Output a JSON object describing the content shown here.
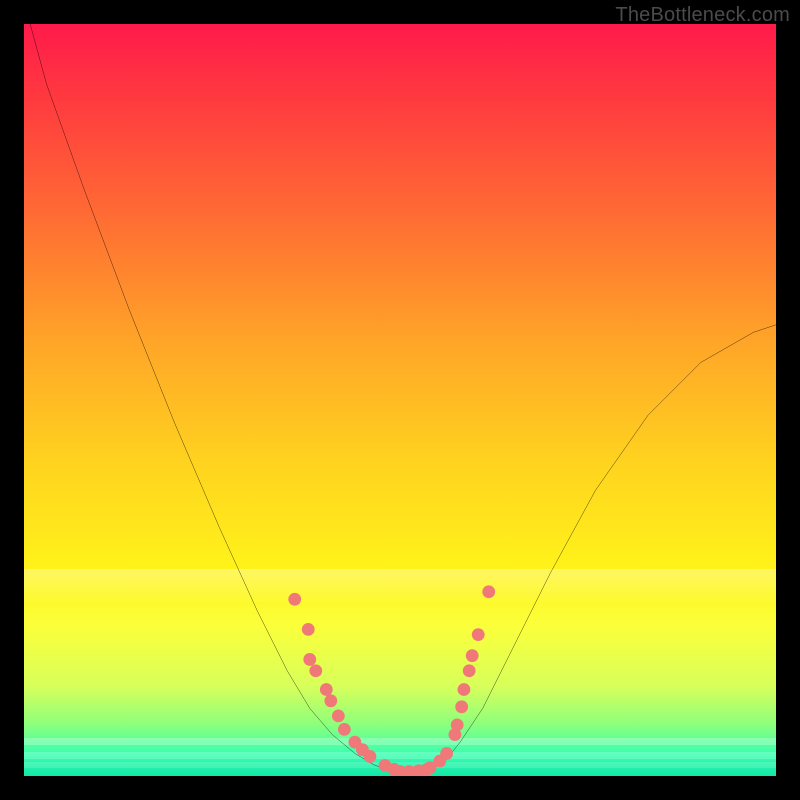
{
  "watermark": {
    "text": "TheBottleneck.com"
  },
  "colors": {
    "frame": "#000000",
    "curve": "#000000",
    "marker": "#f07878",
    "gradient_top": "#ff1a4b",
    "gradient_bottom": "#12e8a8"
  },
  "chart_data": {
    "type": "line",
    "title": "",
    "xlabel": "",
    "ylabel": "",
    "xlim": [
      0,
      100
    ],
    "ylim": [
      0,
      100
    ],
    "grid": false,
    "series": [
      {
        "name": "bottleneck-curve",
        "x": [
          0,
          3,
          8,
          14,
          20,
          26,
          31,
          35,
          38,
          41,
          44,
          46.5,
          48.5,
          50,
          52,
          54,
          56,
          58,
          61,
          65,
          70,
          76,
          83,
          90,
          97,
          100
        ],
        "y": [
          103,
          92,
          78,
          62,
          47,
          33,
          22,
          14,
          9,
          5.5,
          3,
          1.5,
          0.7,
          0.3,
          0.3,
          0.8,
          2,
          4.5,
          9,
          17,
          27,
          38,
          48,
          55,
          59,
          60
        ]
      }
    ],
    "markers": [
      {
        "x": 36.0,
        "y": 23.5
      },
      {
        "x": 37.8,
        "y": 19.5
      },
      {
        "x": 38.0,
        "y": 15.5
      },
      {
        "x": 38.8,
        "y": 14.0
      },
      {
        "x": 40.2,
        "y": 11.5
      },
      {
        "x": 40.8,
        "y": 10.0
      },
      {
        "x": 41.8,
        "y": 8.0
      },
      {
        "x": 42.6,
        "y": 6.2
      },
      {
        "x": 44.0,
        "y": 4.5
      },
      {
        "x": 45.0,
        "y": 3.5
      },
      {
        "x": 46.0,
        "y": 2.6
      },
      {
        "x": 48.0,
        "y": 1.4
      },
      {
        "x": 49.2,
        "y": 0.9
      },
      {
        "x": 50.0,
        "y": 0.6
      },
      {
        "x": 51.2,
        "y": 0.6
      },
      {
        "x": 52.5,
        "y": 0.7
      },
      {
        "x": 53.6,
        "y": 0.9
      },
      {
        "x": 54.0,
        "y": 1.1
      },
      {
        "x": 55.3,
        "y": 2.0
      },
      {
        "x": 56.2,
        "y": 3.0
      },
      {
        "x": 57.3,
        "y": 5.5
      },
      {
        "x": 57.6,
        "y": 6.8
      },
      {
        "x": 58.2,
        "y": 9.2
      },
      {
        "x": 58.5,
        "y": 11.5
      },
      {
        "x": 59.2,
        "y": 14.0
      },
      {
        "x": 59.6,
        "y": 16.0
      },
      {
        "x": 60.4,
        "y": 18.8
      },
      {
        "x": 61.8,
        "y": 24.5
      }
    ]
  }
}
